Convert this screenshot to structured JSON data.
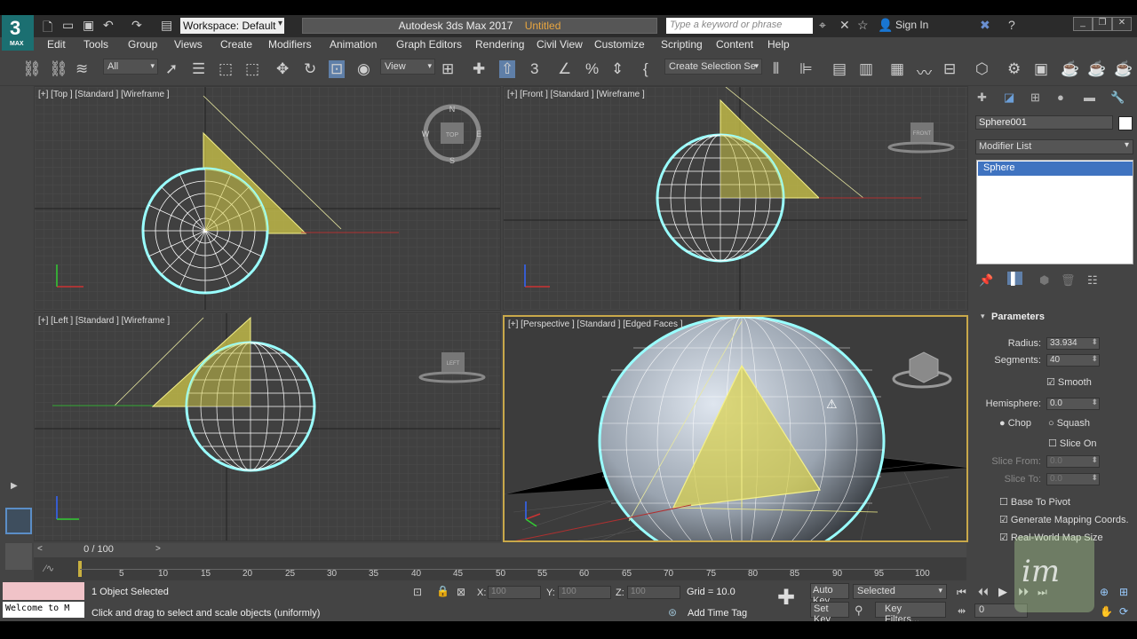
{
  "app": {
    "logo_number": "3",
    "logo_text": "MAX",
    "workspace": "Workspace: Default",
    "title_app": "Autodesk 3ds Max 2017",
    "title_file": "Untitled",
    "search_placeholder": "Type a keyword or phrase",
    "sign_in": "Sign In"
  },
  "menu": [
    "Edit",
    "Tools",
    "Group",
    "Views",
    "Create",
    "Modifiers",
    "Animation",
    "Graph Editors",
    "Rendering",
    "Civil View",
    "Customize",
    "Scripting",
    "Content",
    "Help"
  ],
  "toolbar": {
    "filter": "All",
    "ref_coord": "View",
    "selection_set": "Create Selection Se"
  },
  "viewports": {
    "top": "[+] [Top ] [Standard ] [Wireframe ]",
    "front": "[+] [Front ] [Standard ] [Wireframe ]",
    "left": "[+] [Left ] [Standard ] [Wireframe ]",
    "perspective": "[+] [Perspective ] [Standard ] [Edged Faces ]",
    "cube_top": "TOP",
    "cube_front": "FRONT",
    "cube_left": "LEFT",
    "compass_n": "N",
    "compass_s": "S",
    "compass_e": "E",
    "compass_w": "W"
  },
  "command_panel": {
    "object_name": "Sphere001",
    "modifier_list": "Modifier List",
    "stack_item": "Sphere",
    "params_title": "Parameters",
    "radius_label": "Radius:",
    "radius_value": "33.934",
    "segments_label": "Segments:",
    "segments_value": "40",
    "smooth_label": "Smooth",
    "hemisphere_label": "Hemisphere:",
    "hemisphere_value": "0.0",
    "chop_label": "Chop",
    "squash_label": "Squash",
    "slice_on_label": "Slice On",
    "slice_from_label": "Slice From:",
    "slice_from_value": "0.0",
    "slice_to_label": "Slice To:",
    "slice_to_value": "0.0",
    "base_to_pivot_label": "Base To Pivot",
    "gen_mapping_label": "Generate Mapping Coords.",
    "real_world_label": "Real-World Map Size"
  },
  "timeline": {
    "frame_label": "0 / 100",
    "ticks": [
      "5",
      "10",
      "15",
      "20",
      "25",
      "30",
      "35",
      "40",
      "45",
      "50",
      "55",
      "60",
      "65",
      "70",
      "75",
      "80",
      "85",
      "90",
      "95",
      "100"
    ]
  },
  "status": {
    "welcome": "Welcome to M",
    "objects_selected": "1 Object Selected",
    "prompt": "Click and drag to select and scale objects (uniformly)",
    "x_label": "X:",
    "x_value": "100",
    "y_label": "Y:",
    "y_value": "100",
    "z_label": "Z:",
    "z_value": "100",
    "grid": "Grid = 10.0",
    "add_time_tag": "Add Time Tag",
    "auto_key": "Auto Key",
    "set_key": "Set Key",
    "selected": "Selected",
    "key_filters": "Key Filters...",
    "current_frame": "0"
  },
  "watermark": "im"
}
